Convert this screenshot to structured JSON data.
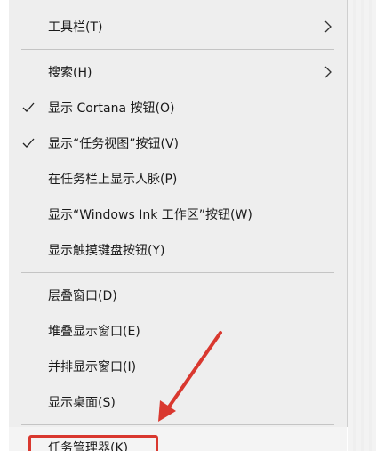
{
  "context_menu": {
    "items": [
      {
        "label": "工具栏(T)",
        "checked": false,
        "has_submenu": true
      },
      {
        "label": "搜索(H)",
        "checked": false,
        "has_submenu": true
      },
      {
        "label": "显示 Cortana 按钮(O)",
        "checked": true,
        "has_submenu": false
      },
      {
        "label": "显示“任务视图”按钮(V)",
        "checked": true,
        "has_submenu": false
      },
      {
        "label": "在任务栏上显示人脉(P)",
        "checked": false,
        "has_submenu": false
      },
      {
        "label": "显示“Windows Ink 工作区”按钮(W)",
        "checked": false,
        "has_submenu": false
      },
      {
        "label": "显示触摸键盘按钮(Y)",
        "checked": false,
        "has_submenu": false
      },
      {
        "label": "层叠窗口(D)",
        "checked": false,
        "has_submenu": false
      },
      {
        "label": "堆叠显示窗口(E)",
        "checked": false,
        "has_submenu": false
      },
      {
        "label": "并排显示窗口(I)",
        "checked": false,
        "has_submenu": false
      },
      {
        "label": "显示桌面(S)",
        "checked": false,
        "has_submenu": false
      },
      {
        "label": "任务管理器(K)",
        "checked": false,
        "has_submenu": false
      }
    ]
  },
  "annotation": {
    "highlight_color": "#d9382f",
    "icons": [
      "check-icon",
      "chevron-right-icon",
      "red-arrow-icon"
    ]
  }
}
